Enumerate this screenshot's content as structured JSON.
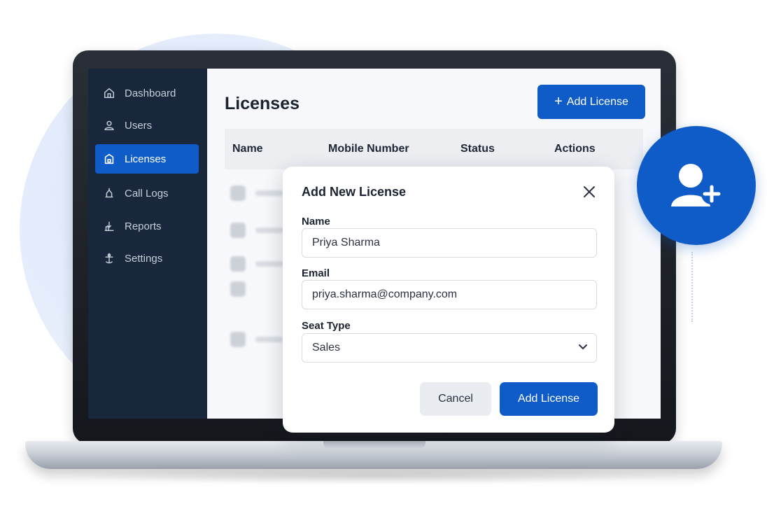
{
  "sidebar": {
    "items": [
      {
        "label": "Dashboard",
        "icon": "home-icon"
      },
      {
        "label": "Users",
        "icon": "users-icon"
      },
      {
        "label": "Licenses",
        "icon": "license-icon",
        "active": true
      },
      {
        "label": "Call Logs",
        "icon": "call-log-icon"
      },
      {
        "label": "Reports",
        "icon": "reports-icon"
      },
      {
        "label": "Settings",
        "icon": "settings-icon"
      }
    ]
  },
  "main": {
    "title": "Licenses",
    "add_button_label": "Add License",
    "add_button_icon": "plus-icon",
    "table": {
      "columns": [
        "Name",
        "Mobile Number",
        "Status",
        "Actions"
      ]
    }
  },
  "modal": {
    "title": "Add New License",
    "close_icon": "close-icon",
    "fields": {
      "name": {
        "label": "Name",
        "value": "Priya Sharma"
      },
      "email": {
        "label": "Email",
        "value": "priya.sharma@company.com"
      },
      "seat_type": {
        "label": "Seat Type",
        "value": "Sales"
      }
    },
    "cancel_label": "Cancel",
    "submit_label": "Add License"
  },
  "badge": {
    "icon": "add-user-icon"
  },
  "colors": {
    "accent": "#0f5cc8",
    "sidebar_bg": "#18273b",
    "cancel_bg": "#e9ecf0"
  }
}
